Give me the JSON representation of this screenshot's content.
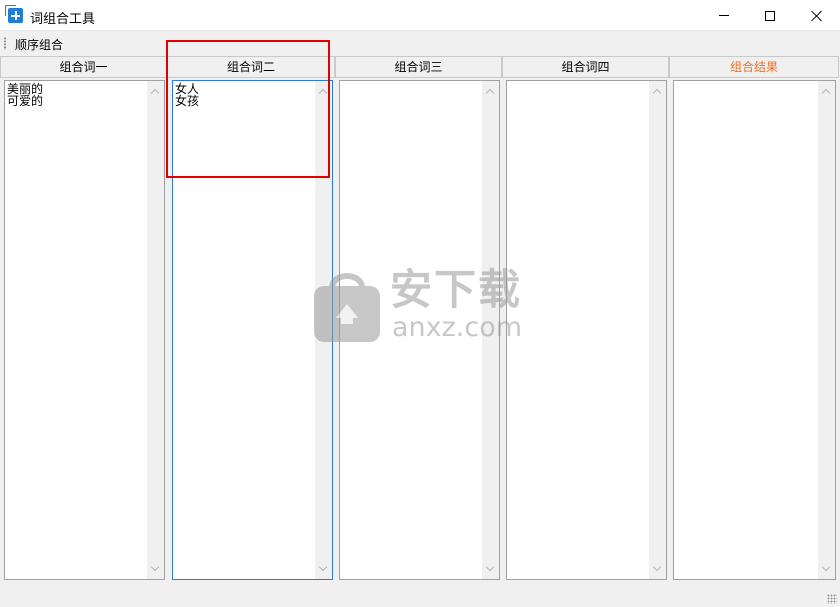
{
  "window": {
    "title": "词组合工具",
    "controls": {
      "minimize": "minimize",
      "maximize": "maximize",
      "close": "close"
    }
  },
  "toolbar": {
    "sequential_combine_label": "顺序组合"
  },
  "columns": [
    {
      "header": "组合词一",
      "content": "美丽的\n可爱的"
    },
    {
      "header": "组合词二",
      "content": "女人\n女孩"
    },
    {
      "header": "组合词三",
      "content": ""
    },
    {
      "header": "组合词四",
      "content": ""
    },
    {
      "header": "组合结果",
      "content": ""
    }
  ],
  "watermark": {
    "cn": "安下载",
    "en": "anxz.com"
  },
  "colors": {
    "result_header": "#f07020",
    "highlight": "#e00000",
    "focus_border": "#2b7ad8"
  }
}
